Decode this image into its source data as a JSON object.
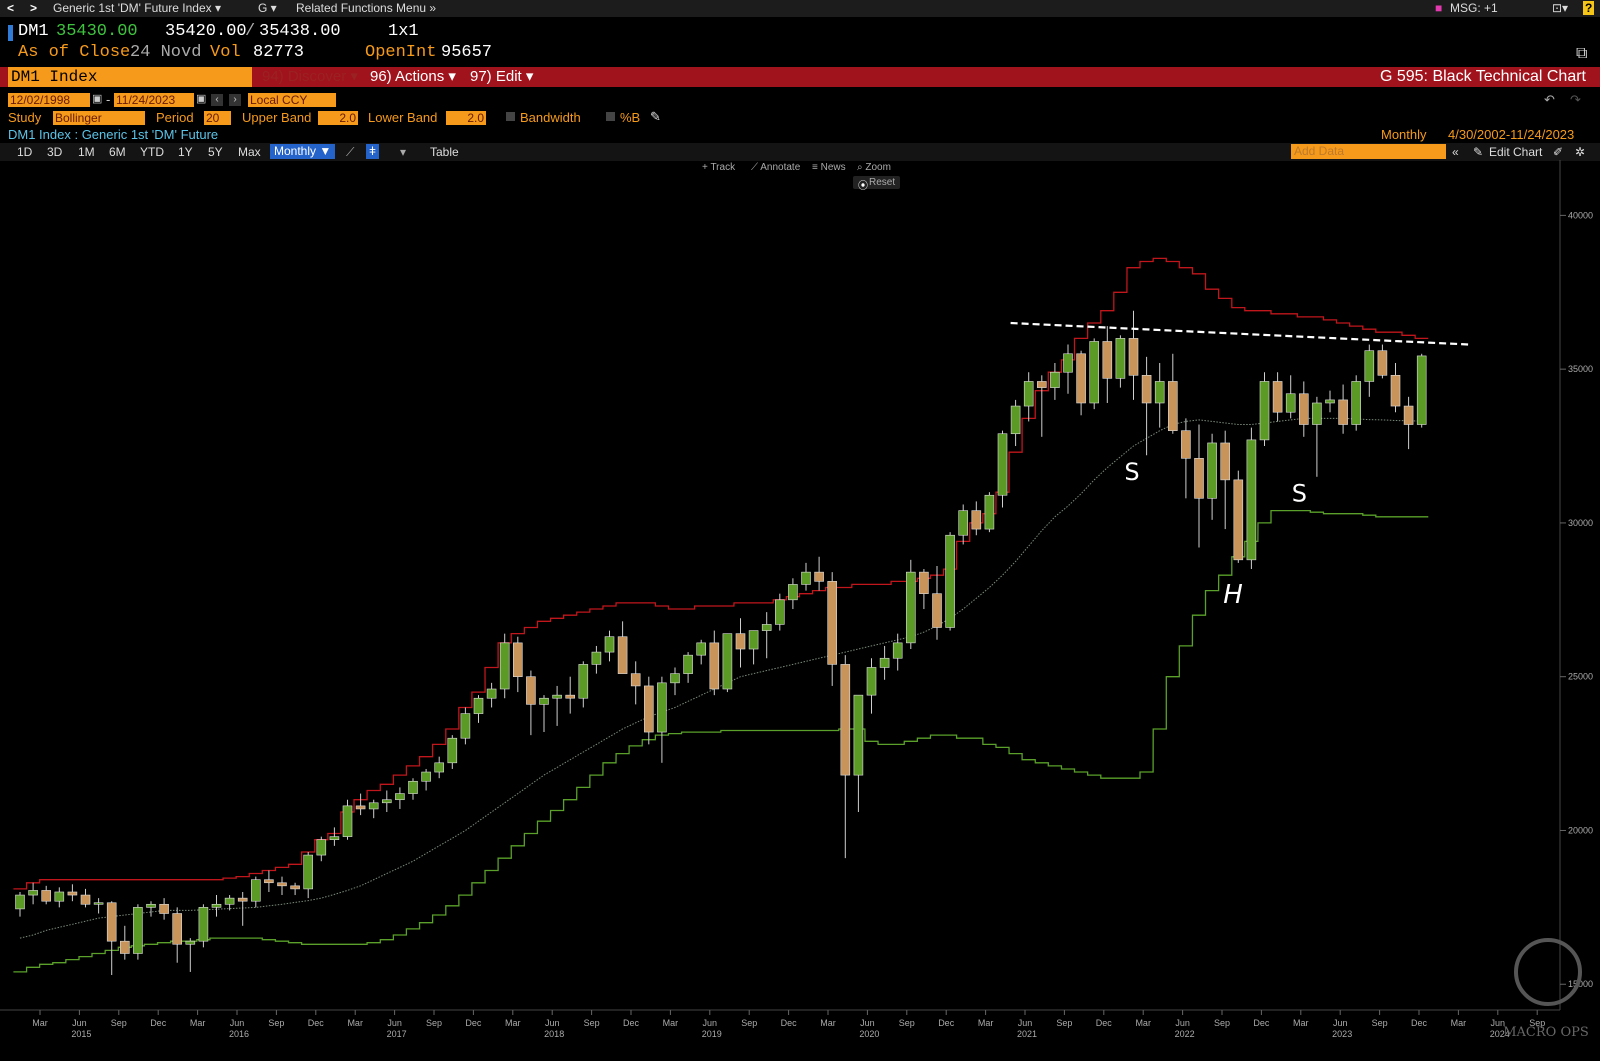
{
  "topbar": {
    "back": "<",
    "forward": ">",
    "security_menu": "Generic 1st 'DM' Future Index ▾",
    "g_menu": "G ▾",
    "related_menu": "Related Functions Menu »",
    "msg": "MSG: +1",
    "help": "?"
  },
  "quote": {
    "symbol": "DM1",
    "last": "35430.00",
    "bid": "35420.00",
    "slash": "/",
    "ask": "35438.00",
    "size": "1x1",
    "as_of_label": "As of Close",
    "as_of_date": "24 Novd",
    "vol_label": "Vol",
    "vol": "82773",
    "openint_label": "OpenInt",
    "openint": "95657"
  },
  "command": {
    "ticker": "DM1 Index",
    "discover": "94) Discover ▾",
    "actions": "96) Actions ▾",
    "edit": "97) Edit ▾",
    "function_title": "G 595: Black Technical Chart"
  },
  "settings": {
    "start_date": "12/02/1998",
    "dash": "-",
    "end_date": "11/24/2023",
    "currency": "Local CCY",
    "study_label": "Study",
    "study": "Bollinger",
    "period_label": "Period",
    "period": "20",
    "upper_label": "Upper Band",
    "upper": "2.0",
    "lower_label": "Lower Band",
    "lower": "2.0",
    "bandwidth_label": "Bandwidth",
    "pctb_label": "%B",
    "security_desc": "DM1 Index : Generic 1st 'DM' Future",
    "frequency": "Monthly",
    "range": "4/30/2002-11/24/2023"
  },
  "timeframes": [
    "1D",
    "3D",
    "1M",
    "6M",
    "YTD",
    "1Y",
    "5Y",
    "Max"
  ],
  "timeframe_selected": "Monthly ▼",
  "table_label": "Table",
  "add_data_placeholder": "Add Data",
  "edit_chart": "Edit Chart",
  "tools": {
    "track": "+ Track",
    "annotate": "⟋ Annotate",
    "news": "≡ News",
    "zoom": "⌕ Zoom",
    "reset": "Reset"
  },
  "annotations": {
    "left_shoulder": "S",
    "right_shoulder": "S",
    "head": "H"
  },
  "watermark": "MACRO OPS",
  "colors": {
    "up": "#5a9a25",
    "down": "#c8945a",
    "upper_band": "#c0161c",
    "lower_band": "#5aa02a",
    "mid_band": "#7a8a7a",
    "accent": "#f59a1b"
  },
  "chart_data": {
    "type": "candlestick",
    "frequency": "Monthly",
    "ylim": [
      14000,
      40500
    ],
    "y_ticks": [
      15000,
      20000,
      25000,
      30000,
      35000,
      40000
    ],
    "x_ticks": [
      {
        "m": "Mar",
        "y": ""
      },
      {
        "m": "Jun",
        "y": "2015"
      },
      {
        "m": "Sep",
        "y": ""
      },
      {
        "m": "Dec",
        "y": ""
      },
      {
        "m": "Mar",
        "y": ""
      },
      {
        "m": "Jun",
        "y": "2016"
      },
      {
        "m": "Sep",
        "y": ""
      },
      {
        "m": "Dec",
        "y": ""
      },
      {
        "m": "Mar",
        "y": ""
      },
      {
        "m": "Jun",
        "y": "2017"
      },
      {
        "m": "Sep",
        "y": ""
      },
      {
        "m": "Dec",
        "y": ""
      },
      {
        "m": "Mar",
        "y": ""
      },
      {
        "m": "Jun",
        "y": "2018"
      },
      {
        "m": "Sep",
        "y": ""
      },
      {
        "m": "Dec",
        "y": ""
      },
      {
        "m": "Mar",
        "y": ""
      },
      {
        "m": "Jun",
        "y": "2019"
      },
      {
        "m": "Sep",
        "y": ""
      },
      {
        "m": "Dec",
        "y": ""
      },
      {
        "m": "Mar",
        "y": ""
      },
      {
        "m": "Jun",
        "y": "2020"
      },
      {
        "m": "Sep",
        "y": ""
      },
      {
        "m": "Dec",
        "y": ""
      },
      {
        "m": "Mar",
        "y": ""
      },
      {
        "m": "Jun",
        "y": "2021"
      },
      {
        "m": "Sep",
        "y": ""
      },
      {
        "m": "Dec",
        "y": ""
      },
      {
        "m": "Mar",
        "y": ""
      },
      {
        "m": "Jun",
        "y": "2022"
      },
      {
        "m": "Sep",
        "y": ""
      },
      {
        "m": "Dec",
        "y": ""
      },
      {
        "m": "Mar",
        "y": ""
      },
      {
        "m": "Jun",
        "y": "2023"
      },
      {
        "m": "Sep",
        "y": ""
      },
      {
        "m": "Dec",
        "y": ""
      },
      {
        "m": "Mar",
        "y": ""
      },
      {
        "m": "Jun",
        "y": "2024"
      },
      {
        "m": "Sep",
        "y": ""
      }
    ],
    "candles": [
      {
        "o": 17450,
        "h": 18000,
        "l": 17200,
        "c": 17900
      },
      {
        "o": 17900,
        "h": 18300,
        "l": 17600,
        "c": 18050
      },
      {
        "o": 18050,
        "h": 18200,
        "l": 17600,
        "c": 17700
      },
      {
        "o": 17700,
        "h": 18150,
        "l": 17500,
        "c": 18000
      },
      {
        "o": 18000,
        "h": 18250,
        "l": 17700,
        "c": 17900
      },
      {
        "o": 17900,
        "h": 18100,
        "l": 17500,
        "c": 17600
      },
      {
        "o": 17600,
        "h": 17800,
        "l": 17300,
        "c": 17650
      },
      {
        "o": 17650,
        "h": 17700,
        "l": 15300,
        "c": 16400
      },
      {
        "o": 16400,
        "h": 16900,
        "l": 15800,
        "c": 16000
      },
      {
        "o": 16000,
        "h": 17600,
        "l": 15800,
        "c": 17500
      },
      {
        "o": 17500,
        "h": 17700,
        "l": 17200,
        "c": 17600
      },
      {
        "o": 17600,
        "h": 17800,
        "l": 17100,
        "c": 17300
      },
      {
        "o": 17300,
        "h": 17500,
        "l": 15700,
        "c": 16300
      },
      {
        "o": 16300,
        "h": 16500,
        "l": 15400,
        "c": 16400
      },
      {
        "o": 16400,
        "h": 17600,
        "l": 16200,
        "c": 17500
      },
      {
        "o": 17500,
        "h": 17900,
        "l": 17200,
        "c": 17600
      },
      {
        "o": 17600,
        "h": 17900,
        "l": 17400,
        "c": 17800
      },
      {
        "o": 17800,
        "h": 18000,
        "l": 16900,
        "c": 17700
      },
      {
        "o": 17700,
        "h": 18500,
        "l": 17500,
        "c": 18400
      },
      {
        "o": 18400,
        "h": 18700,
        "l": 18000,
        "c": 18300
      },
      {
        "o": 18300,
        "h": 18500,
        "l": 17900,
        "c": 18200
      },
      {
        "o": 18200,
        "h": 18300,
        "l": 17900,
        "c": 18100
      },
      {
        "o": 18100,
        "h": 19300,
        "l": 17800,
        "c": 19200
      },
      {
        "o": 19200,
        "h": 19800,
        "l": 19000,
        "c": 19700
      },
      {
        "o": 19700,
        "h": 20100,
        "l": 19500,
        "c": 19800
      },
      {
        "o": 19800,
        "h": 21000,
        "l": 19700,
        "c": 20800
      },
      {
        "o": 20800,
        "h": 21200,
        "l": 20500,
        "c": 20700
      },
      {
        "o": 20700,
        "h": 21000,
        "l": 20400,
        "c": 20900
      },
      {
        "o": 20900,
        "h": 21300,
        "l": 20600,
        "c": 21000
      },
      {
        "o": 21000,
        "h": 21400,
        "l": 20700,
        "c": 21200
      },
      {
        "o": 21200,
        "h": 21700,
        "l": 21000,
        "c": 21600
      },
      {
        "o": 21600,
        "h": 22000,
        "l": 21300,
        "c": 21900
      },
      {
        "o": 21900,
        "h": 22400,
        "l": 21700,
        "c": 22200
      },
      {
        "o": 22200,
        "h": 23100,
        "l": 22000,
        "c": 23000
      },
      {
        "o": 23000,
        "h": 24000,
        "l": 22800,
        "c": 23800
      },
      {
        "o": 23800,
        "h": 24400,
        "l": 23500,
        "c": 24300
      },
      {
        "o": 24300,
        "h": 24800,
        "l": 24000,
        "c": 24600
      },
      {
        "o": 24600,
        "h": 26400,
        "l": 24300,
        "c": 26100
      },
      {
        "o": 26100,
        "h": 26300,
        "l": 24500,
        "c": 25000
      },
      {
        "o": 25000,
        "h": 25200,
        "l": 23100,
        "c": 24100
      },
      {
        "o": 24100,
        "h": 24400,
        "l": 23200,
        "c": 24300
      },
      {
        "o": 24300,
        "h": 24700,
        "l": 23400,
        "c": 24400
      },
      {
        "o": 24400,
        "h": 25000,
        "l": 23800,
        "c": 24300
      },
      {
        "o": 24300,
        "h": 25500,
        "l": 24000,
        "c": 25400
      },
      {
        "o": 25400,
        "h": 26000,
        "l": 25100,
        "c": 25800
      },
      {
        "o": 25800,
        "h": 26500,
        "l": 25500,
        "c": 26300
      },
      {
        "o": 26300,
        "h": 26800,
        "l": 25800,
        "c": 25100
      },
      {
        "o": 25100,
        "h": 25500,
        "l": 24100,
        "c": 24700
      },
      {
        "o": 24700,
        "h": 25000,
        "l": 22800,
        "c": 23200
      },
      {
        "o": 23200,
        "h": 25000,
        "l": 22200,
        "c": 24800
      },
      {
        "o": 24800,
        "h": 25300,
        "l": 24400,
        "c": 25100
      },
      {
        "o": 25100,
        "h": 25800,
        "l": 24800,
        "c": 25700
      },
      {
        "o": 25700,
        "h": 26200,
        "l": 25400,
        "c": 26100
      },
      {
        "o": 26100,
        "h": 26500,
        "l": 24400,
        "c": 24600
      },
      {
        "o": 24600,
        "h": 26400,
        "l": 24500,
        "c": 26400
      },
      {
        "o": 26400,
        "h": 26900,
        "l": 25300,
        "c": 25900
      },
      {
        "o": 25900,
        "h": 26500,
        "l": 25400,
        "c": 26500
      },
      {
        "o": 26500,
        "h": 27100,
        "l": 25600,
        "c": 26700
      },
      {
        "o": 26700,
        "h": 27700,
        "l": 26500,
        "c": 27500
      },
      {
        "o": 27500,
        "h": 28200,
        "l": 27200,
        "c": 28000
      },
      {
        "o": 28000,
        "h": 28700,
        "l": 27800,
        "c": 28400
      },
      {
        "o": 28400,
        "h": 28900,
        "l": 27800,
        "c": 28100
      },
      {
        "o": 28100,
        "h": 28400,
        "l": 24700,
        "c": 25400
      },
      {
        "o": 25400,
        "h": 25700,
        "l": 19100,
        "c": 21800
      },
      {
        "o": 21800,
        "h": 24300,
        "l": 20600,
        "c": 24400
      },
      {
        "o": 24400,
        "h": 25600,
        "l": 23800,
        "c": 25300
      },
      {
        "o": 25300,
        "h": 26000,
        "l": 24900,
        "c": 25600
      },
      {
        "o": 25600,
        "h": 26400,
        "l": 25200,
        "c": 26100
      },
      {
        "o": 26100,
        "h": 28800,
        "l": 25900,
        "c": 28400
      },
      {
        "o": 28400,
        "h": 28500,
        "l": 27200,
        "c": 27700
      },
      {
        "o": 27700,
        "h": 28600,
        "l": 26200,
        "c": 26600
      },
      {
        "o": 26600,
        "h": 29700,
        "l": 26500,
        "c": 29600
      },
      {
        "o": 29600,
        "h": 30600,
        "l": 29300,
        "c": 30400
      },
      {
        "o": 30400,
        "h": 30700,
        "l": 29600,
        "c": 29800
      },
      {
        "o": 29800,
        "h": 31000,
        "l": 29700,
        "c": 30900
      },
      {
        "o": 30900,
        "h": 33000,
        "l": 30500,
        "c": 32900
      },
      {
        "o": 32900,
        "h": 34000,
        "l": 32500,
        "c": 33800
      },
      {
        "o": 33800,
        "h": 34900,
        "l": 33300,
        "c": 34600
      },
      {
        "o": 34600,
        "h": 34800,
        "l": 32800,
        "c": 34400
      },
      {
        "o": 34400,
        "h": 35200,
        "l": 34000,
        "c": 34900
      },
      {
        "o": 34900,
        "h": 35800,
        "l": 34200,
        "c": 35500
      },
      {
        "o": 35500,
        "h": 35600,
        "l": 33500,
        "c": 33900
      },
      {
        "o": 33900,
        "h": 36000,
        "l": 33700,
        "c": 35900
      },
      {
        "o": 35900,
        "h": 36400,
        "l": 33900,
        "c": 34700
      },
      {
        "o": 34700,
        "h": 36100,
        "l": 34400,
        "c": 36000
      },
      {
        "o": 36000,
        "h": 36900,
        "l": 34000,
        "c": 34800
      },
      {
        "o": 34800,
        "h": 35400,
        "l": 32200,
        "c": 33900
      },
      {
        "o": 33900,
        "h": 35200,
        "l": 33100,
        "c": 34600
      },
      {
        "o": 34600,
        "h": 35500,
        "l": 32900,
        "c": 33000
      },
      {
        "o": 33000,
        "h": 33400,
        "l": 30800,
        "c": 32100
      },
      {
        "o": 32100,
        "h": 33200,
        "l": 29200,
        "c": 30800
      },
      {
        "o": 30800,
        "h": 32900,
        "l": 30100,
        "c": 32600
      },
      {
        "o": 32600,
        "h": 33000,
        "l": 29800,
        "c": 31400
      },
      {
        "o": 31400,
        "h": 31700,
        "l": 28700,
        "c": 28800
      },
      {
        "o": 28800,
        "h": 33100,
        "l": 28500,
        "c": 32700
      },
      {
        "o": 32700,
        "h": 34900,
        "l": 32500,
        "c": 34600
      },
      {
        "o": 34600,
        "h": 34900,
        "l": 33300,
        "c": 33600
      },
      {
        "o": 33600,
        "h": 34800,
        "l": 33400,
        "c": 34200
      },
      {
        "o": 34200,
        "h": 34600,
        "l": 32800,
        "c": 33200
      },
      {
        "o": 33200,
        "h": 34100,
        "l": 31500,
        "c": 33900
      },
      {
        "o": 33900,
        "h": 34300,
        "l": 33600,
        "c": 34000
      },
      {
        "o": 34000,
        "h": 34500,
        "l": 32900,
        "c": 33200
      },
      {
        "o": 33200,
        "h": 34800,
        "l": 33000,
        "c": 34600
      },
      {
        "o": 34600,
        "h": 35800,
        "l": 34100,
        "c": 35600
      },
      {
        "o": 35600,
        "h": 35800,
        "l": 34700,
        "c": 34800
      },
      {
        "o": 34800,
        "h": 35200,
        "l": 33600,
        "c": 33800
      },
      {
        "o": 33800,
        "h": 34100,
        "l": 32400,
        "c": 33200
      },
      {
        "o": 33200,
        "h": 35500,
        "l": 33100,
        "c": 35430
      }
    ],
    "upper_band": [
      18100,
      18300,
      18400,
      18400,
      18400,
      18400,
      18400,
      18400,
      18400,
      18400,
      18400,
      18400,
      18400,
      18400,
      18400,
      18400,
      18450,
      18500,
      18600,
      18700,
      18800,
      18900,
      19300,
      19700,
      19900,
      20600,
      21000,
      21300,
      21500,
      21800,
      22100,
      22400,
      22800,
      23300,
      24000,
      24500,
      25300,
      26100,
      26400,
      26600,
      26800,
      26900,
      27000,
      27100,
      27200,
      27300,
      27400,
      27400,
      27400,
      27300,
      27200,
      27200,
      27300,
      27300,
      27300,
      27400,
      27400,
      27400,
      27500,
      27600,
      27700,
      27800,
      27900,
      27900,
      28000,
      28000,
      28000,
      28100,
      28100,
      28200,
      28300,
      28500,
      29400,
      30000,
      30300,
      31000,
      32300,
      33400,
      34300,
      34900,
      35300,
      36000,
      36500,
      36900,
      37500,
      38300,
      38500,
      38600,
      38500,
      38300,
      38100,
      37600,
      37300,
      37000,
      36900,
      36900,
      36800,
      36800,
      36700,
      36700,
      36600,
      36500,
      36400,
      36300,
      36200,
      36200,
      36100,
      36000
    ],
    "mid_band": [
      16500,
      16600,
      16750,
      16850,
      16950,
      17050,
      17150,
      17200,
      17250,
      17300,
      17350,
      17400,
      17400,
      17400,
      17420,
      17440,
      17460,
      17480,
      17500,
      17550,
      17600,
      17660,
      17720,
      17800,
      17920,
      18050,
      18200,
      18400,
      18600,
      18800,
      19000,
      19250,
      19500,
      19750,
      20000,
      20300,
      20600,
      20900,
      21200,
      21500,
      21800,
      22050,
      22300,
      22550,
      22800,
      23050,
      23300,
      23500,
      23700,
      23850,
      24000,
      24200,
      24400,
      24600,
      24800,
      25000,
      25100,
      25200,
      25300,
      25400,
      25500,
      25600,
      25700,
      25800,
      25900,
      26000,
      26100,
      26200,
      26300,
      26450,
      26650,
      26900,
      27200,
      27550,
      27900,
      28300,
      28750,
      29250,
      29750,
      30200,
      30550,
      30950,
      31400,
      31800,
      32150,
      32500,
      32750,
      33000,
      33200,
      33300,
      33350,
      33300,
      33250,
      33200,
      33200,
      33250,
      33300,
      33350,
      33400,
      33400,
      33400,
      33400,
      33380,
      33360,
      33350,
      33330,
      33320,
      33310
    ],
    "lower_band": [
      15400,
      15550,
      15650,
      15700,
      15800,
      15900,
      16000,
      16100,
      16200,
      16250,
      16300,
      16350,
      16400,
      16400,
      16450,
      16500,
      16500,
      16500,
      16500,
      16450,
      16400,
      16350,
      16300,
      16300,
      16300,
      16300,
      16300,
      16350,
      16450,
      16600,
      16800,
      17000,
      17250,
      17550,
      17900,
      18300,
      18700,
      19100,
      19500,
      19900,
      20300,
      20650,
      21000,
      21400,
      21800,
      22200,
      22500,
      22750,
      22950,
      23100,
      23150,
      23200,
      23200,
      23200,
      23250,
      23250,
      23250,
      23250,
      23250,
      23250,
      23250,
      23250,
      23250,
      23300,
      23300,
      22900,
      22800,
      22800,
      22900,
      23000,
      23100,
      23100,
      23000,
      23000,
      22800,
      22700,
      22500,
      22300,
      22200,
      22100,
      22000,
      21900,
      21800,
      21700,
      21700,
      21700,
      21900,
      23300,
      25000,
      26000,
      27000,
      27800,
      28300,
      28900,
      29400,
      30000,
      30400,
      30400,
      30400,
      30350,
      30300,
      30300,
      30300,
      30250,
      30200,
      30200,
      30200,
      30200
    ]
  }
}
